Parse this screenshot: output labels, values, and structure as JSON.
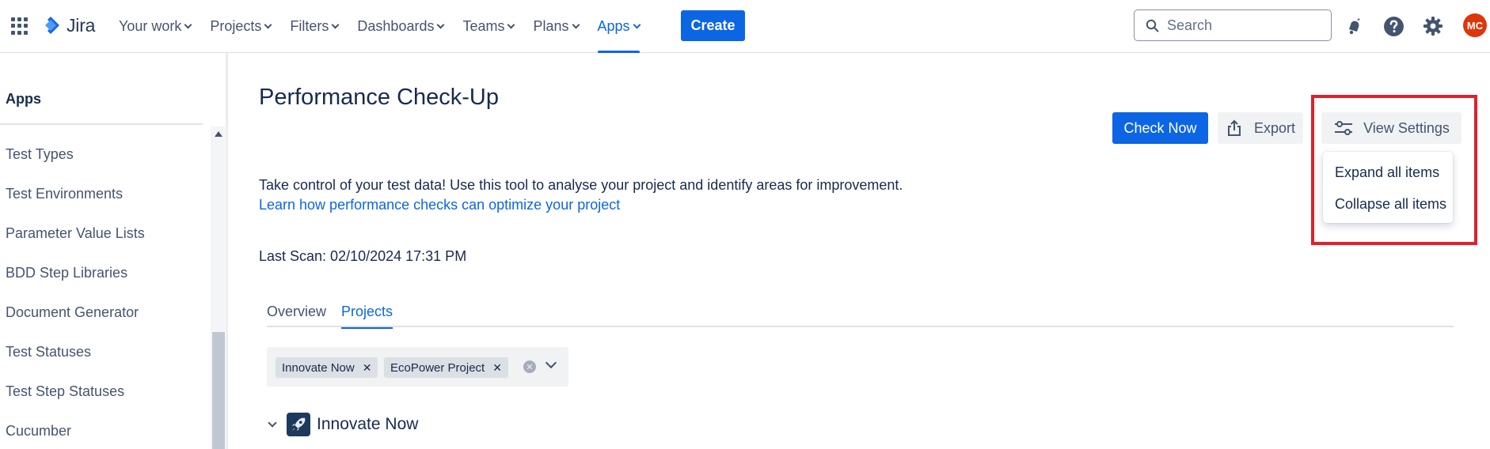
{
  "topnav": {
    "app_name": "Jira",
    "items": [
      {
        "label": "Your work"
      },
      {
        "label": "Projects"
      },
      {
        "label": "Filters"
      },
      {
        "label": "Dashboards"
      },
      {
        "label": "Teams"
      },
      {
        "label": "Plans"
      },
      {
        "label": "Apps",
        "active": true
      }
    ],
    "create_label": "Create",
    "search_placeholder": "Search",
    "avatar_initials": "MC",
    "accent_color": "#0c66e4",
    "avatar_color": "#de350b"
  },
  "sidebar": {
    "heading": "Apps",
    "items": [
      {
        "label": "Test Types"
      },
      {
        "label": "Test Environments"
      },
      {
        "label": "Parameter Value Lists"
      },
      {
        "label": "BDD Step Libraries"
      },
      {
        "label": "Document Generator"
      },
      {
        "label": "Test Statuses"
      },
      {
        "label": "Test Step Statuses"
      },
      {
        "label": "Cucumber"
      }
    ]
  },
  "main": {
    "title": "Performance Check-Up",
    "check_now_label": "Check Now",
    "export_label": "Export",
    "view_settings_label": "View Settings",
    "view_settings_menu": [
      {
        "label": "Expand all items"
      },
      {
        "label": "Collapse all items"
      }
    ],
    "description": "Take control of your test data! Use this tool to analyse your project and identify areas for improvement.",
    "learn_link": "Learn how performance checks can optimize your project",
    "last_scan": "Last Scan: 02/10/2024 17:31 PM",
    "tabs": [
      {
        "label": "Overview"
      },
      {
        "label": "Projects",
        "active": true
      }
    ],
    "selected_projects": [
      {
        "label": "Innovate Now"
      },
      {
        "label": "EcoPower Project"
      }
    ],
    "project_section": {
      "name": "Innovate Now"
    },
    "highlight_color": "#e0202b"
  }
}
